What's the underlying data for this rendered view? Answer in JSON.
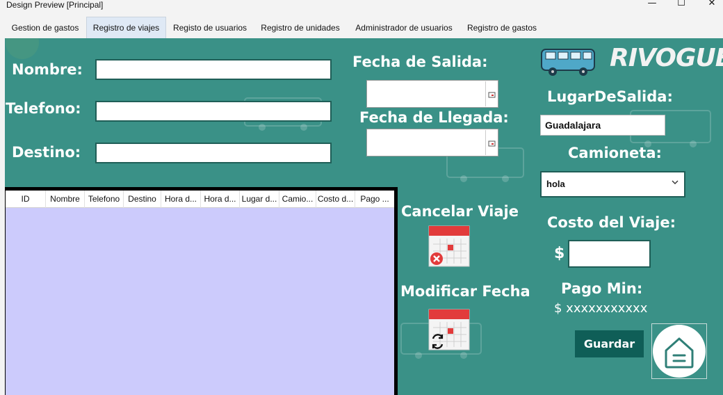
{
  "window": {
    "title": "Design Preview [Principal]",
    "minimize": "—",
    "maximize": "☐",
    "close": "✕"
  },
  "tabs": [
    {
      "label": "Gestion de gastos"
    },
    {
      "label": "Registro de viajes"
    },
    {
      "label": "Registo de usuarios"
    },
    {
      "label": "Registro de unidades"
    },
    {
      "label": "Administrador de usuarios"
    },
    {
      "label": "Registro de gastos"
    }
  ],
  "form": {
    "nombre_label": "Nombre:",
    "telefono_label": "Telefono:",
    "destino_label": "Destino:",
    "nombre_value": "",
    "telefono_value": "",
    "destino_value": "",
    "fecha_salida_label": "Fecha de Salida:",
    "fecha_llegada_label": "Fecha de Llegada:",
    "fecha_salida_value": "",
    "fecha_llegada_value": ""
  },
  "brand": {
    "name": "RIVOGUE"
  },
  "right": {
    "lugar_label": "LugarDeSalida:",
    "lugar_value": "Guadalajara",
    "camioneta_label": "Camioneta:",
    "camioneta_value": "hola",
    "costo_label": "Costo del Viaje:",
    "currency": "$",
    "costo_value": "",
    "pago_min_label": "Pago Min:",
    "pago_min_value": "$ xxxxxxxxxxx"
  },
  "actions": {
    "cancelar_label": "Cancelar Viaje",
    "modificar_label": "Modificar Fecha",
    "guardar_label": "Guardar"
  },
  "table": {
    "columns": [
      "ID",
      "Nombre",
      "Telefono",
      "Destino",
      "Hora d...",
      "Hora d...",
      "Lugar d...",
      "Camio...",
      "Costo d...",
      "Pago ..."
    ]
  },
  "icons": {
    "van": "van-logo-icon",
    "cancel": "calendar-cancel-icon",
    "modify": "calendar-refresh-icon",
    "home": "home-icon",
    "calendar_picker": "calendar-picker-icon",
    "chevron": "chevron-down-icon"
  },
  "colors": {
    "panel": "#3a9187",
    "grid_body": "#cccbfc",
    "button": "#0f5e57",
    "label": "#ffffff"
  }
}
